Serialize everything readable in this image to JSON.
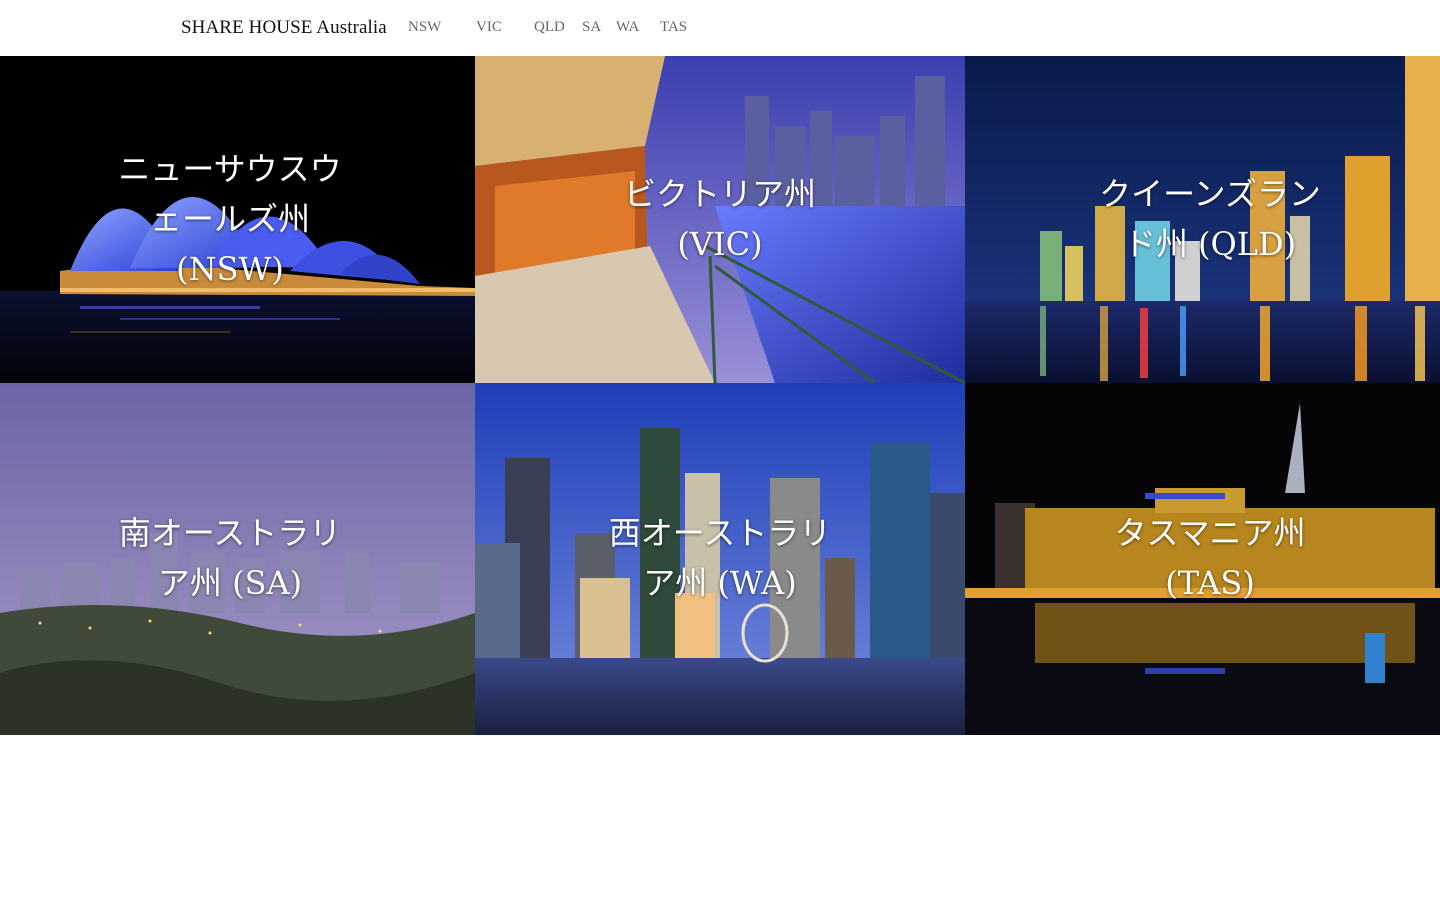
{
  "header": {
    "brand": "SHARE HOUSE Australia",
    "nav": [
      "NSW",
      "VIC",
      "QLD",
      "SA",
      "WA",
      "TAS"
    ]
  },
  "tiles": [
    {
      "state": "NSW",
      "caption_lines": [
        "ニューサウスウ",
        "ェールズ州",
        "(NSW)"
      ]
    },
    {
      "state": "VIC",
      "caption_lines": [
        "ビクトリア州",
        "(VIC)"
      ]
    },
    {
      "state": "QLD",
      "caption_lines": [
        "クイーンズラン",
        "ド州 (QLD)"
      ]
    },
    {
      "state": "SA",
      "caption_lines": [
        "南オーストラリ",
        "ア州 (SA)"
      ]
    },
    {
      "state": "WA",
      "caption_lines": [
        "西オーストラリ",
        "ア州 (WA)"
      ]
    },
    {
      "state": "TAS",
      "caption_lines": [
        "タスマニア州",
        "(TAS)"
      ]
    }
  ]
}
